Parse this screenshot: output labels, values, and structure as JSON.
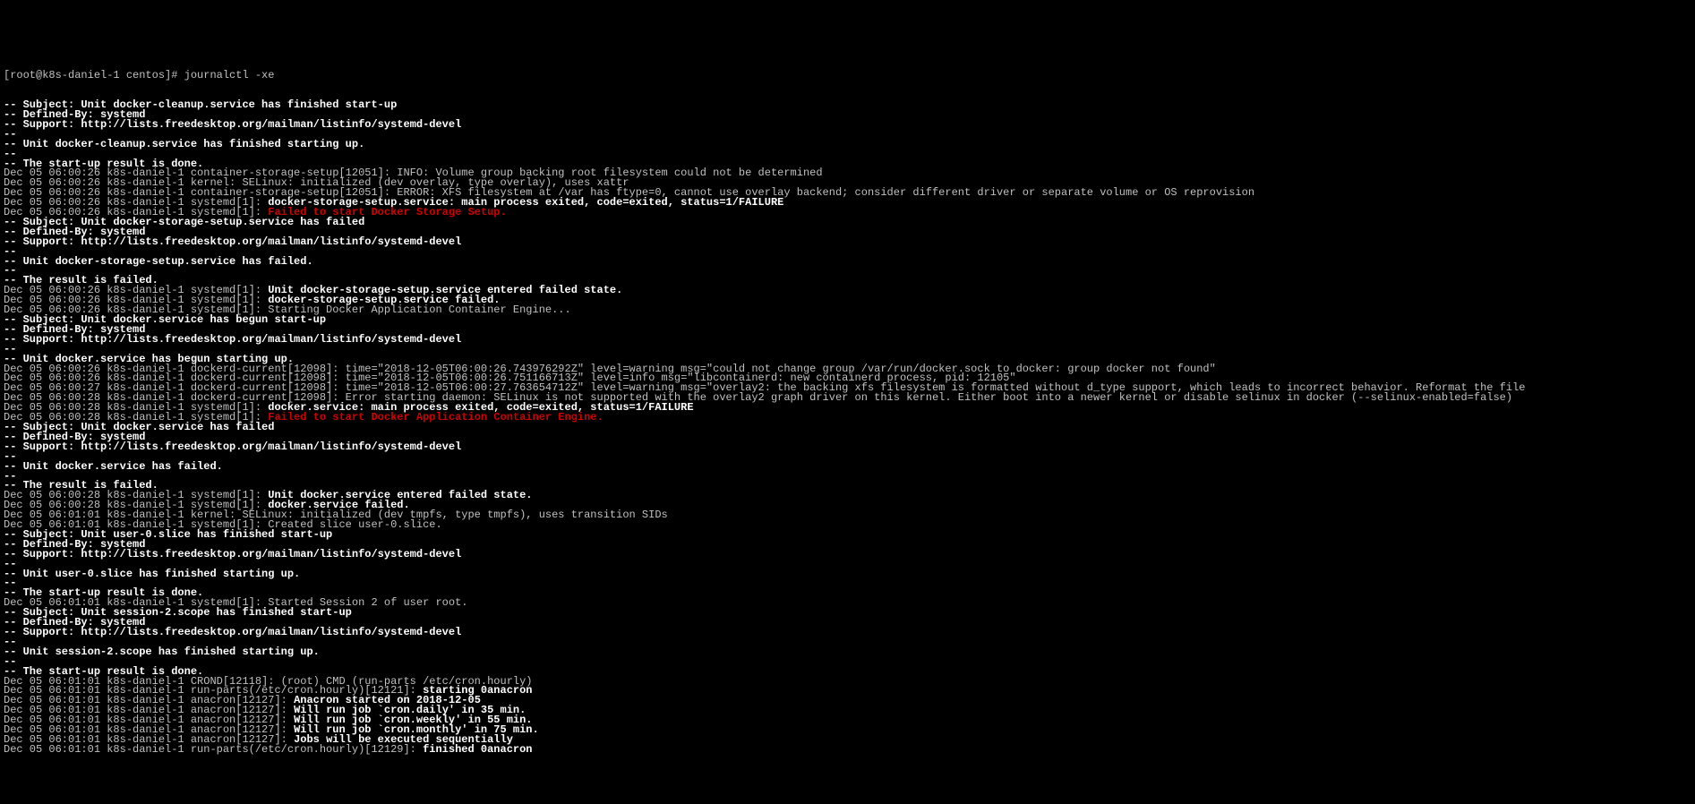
{
  "fs": " ",
  "prompt": "[root@k8s-daniel-1 centos]# ",
  "cmd": "journalctl -xe",
  "lines": [
    [
      "b",
      "-- Subject: Unit docker-cleanup.service has finished start-up"
    ],
    [
      "b",
      "-- Defined-By: systemd"
    ],
    [
      "b",
      "-- Support: http://lists.freedesktop.org/mailman/listinfo/systemd-devel"
    ],
    [
      "b",
      "--"
    ],
    [
      "b",
      "-- Unit docker-cleanup.service has finished starting up."
    ],
    [
      "b",
      "--"
    ],
    [
      "b",
      "-- The start-up result is done."
    ],
    [
      "n",
      "Dec 05 06:00:26 k8s-daniel-1 container-storage-setup[12051]: INFO: Volume group backing root filesystem could not be determined"
    ],
    [
      "n",
      "Dec 05 06:00:26 k8s-daniel-1 kernel: SELinux: initialized (dev overlay, type overlay), uses xattr"
    ],
    [
      "n",
      "Dec 05 06:00:26 k8s-daniel-1 container-storage-setup[12051]: ERROR: XFS filesystem at /var has ftype=0, cannot use overlay backend; consider different driver or separate volume or OS reprovision"
    ],
    [
      [
        "n",
        "Dec 05 06:00:26 k8s-daniel-1 systemd[1]: "
      ],
      [
        "b",
        "docker-storage-setup.service: main process exited, code=exited, status=1/FAILURE"
      ]
    ],
    [
      [
        "n",
        "Dec 05 06:00:26 k8s-daniel-1 systemd[1]: "
      ],
      [
        "r",
        "Failed to start Docker Storage Setup."
      ]
    ],
    [
      "b",
      "-- Subject: Unit docker-storage-setup.service has failed"
    ],
    [
      "b",
      "-- Defined-By: systemd"
    ],
    [
      "b",
      "-- Support: http://lists.freedesktop.org/mailman/listinfo/systemd-devel"
    ],
    [
      "b",
      "--"
    ],
    [
      "b",
      "-- Unit docker-storage-setup.service has failed."
    ],
    [
      "b",
      "--"
    ],
    [
      "b",
      "-- The result is failed."
    ],
    [
      [
        "n",
        "Dec 05 06:00:26 k8s-daniel-1 systemd[1]: "
      ],
      [
        "b",
        "Unit docker-storage-setup.service entered failed state."
      ]
    ],
    [
      [
        "n",
        "Dec 05 06:00:26 k8s-daniel-1 systemd[1]: "
      ],
      [
        "b",
        "docker-storage-setup.service failed."
      ]
    ],
    [
      "n",
      "Dec 05 06:00:26 k8s-daniel-1 systemd[1]: Starting Docker Application Container Engine..."
    ],
    [
      "b",
      "-- Subject: Unit docker.service has begun start-up"
    ],
    [
      "b",
      "-- Defined-By: systemd"
    ],
    [
      "b",
      "-- Support: http://lists.freedesktop.org/mailman/listinfo/systemd-devel"
    ],
    [
      "b",
      "--"
    ],
    [
      "b",
      "-- Unit docker.service has begun starting up."
    ],
    [
      "n",
      "Dec 05 06:00:26 k8s-daniel-1 dockerd-current[12098]: time=\"2018-12-05T06:00:26.743976292Z\" level=warning msg=\"could not change group /var/run/docker.sock to docker: group docker not found\""
    ],
    [
      "n",
      "Dec 05 06:00:26 k8s-daniel-1 dockerd-current[12098]: time=\"2018-12-05T06:00:26.751166713Z\" level=info msg=\"libcontainerd: new containerd process, pid: 12105\""
    ],
    [
      "n",
      "Dec 05 06:00:27 k8s-daniel-1 dockerd-current[12098]: time=\"2018-12-05T06:00:27.763654712Z\" level=warning msg=\"overlay2: the backing xfs filesystem is formatted without d_type support, which leads to incorrect behavior. Reformat the file"
    ],
    [
      "n",
      "Dec 05 06:00:28 k8s-daniel-1 dockerd-current[12098]: Error starting daemon: SELinux is not supported with the overlay2 graph driver on this kernel. Either boot into a newer kernel or disable selinux in docker (--selinux-enabled=false)"
    ],
    [
      [
        "n",
        "Dec 05 06:00:28 k8s-daniel-1 systemd[1]: "
      ],
      [
        "b",
        "docker.service: main process exited, code=exited, status=1/FAILURE"
      ]
    ],
    [
      [
        "n",
        "Dec 05 06:00:28 k8s-daniel-1 systemd[1]: "
      ],
      [
        "r",
        "Failed to start Docker Application Container Engine."
      ]
    ],
    [
      "b",
      "-- Subject: Unit docker.service has failed"
    ],
    [
      "b",
      "-- Defined-By: systemd"
    ],
    [
      "b",
      "-- Support: http://lists.freedesktop.org/mailman/listinfo/systemd-devel"
    ],
    [
      "b",
      "--"
    ],
    [
      "b",
      "-- Unit docker.service has failed."
    ],
    [
      "b",
      "--"
    ],
    [
      "b",
      "-- The result is failed."
    ],
    [
      [
        "n",
        "Dec 05 06:00:28 k8s-daniel-1 systemd[1]: "
      ],
      [
        "b",
        "Unit docker.service entered failed state."
      ]
    ],
    [
      [
        "n",
        "Dec 05 06:00:28 k8s-daniel-1 systemd[1]: "
      ],
      [
        "b",
        "docker.service failed."
      ]
    ],
    [
      "n",
      "Dec 05 06:01:01 k8s-daniel-1 kernel: SELinux: initialized (dev tmpfs, type tmpfs), uses transition SIDs"
    ],
    [
      "n",
      "Dec 05 06:01:01 k8s-daniel-1 systemd[1]: Created slice user-0.slice."
    ],
    [
      "b",
      "-- Subject: Unit user-0.slice has finished start-up"
    ],
    [
      "b",
      "-- Defined-By: systemd"
    ],
    [
      "b",
      "-- Support: http://lists.freedesktop.org/mailman/listinfo/systemd-devel"
    ],
    [
      "b",
      "--"
    ],
    [
      "b",
      "-- Unit user-0.slice has finished starting up."
    ],
    [
      "b",
      "--"
    ],
    [
      "b",
      "-- The start-up result is done."
    ],
    [
      "n",
      "Dec 05 06:01:01 k8s-daniel-1 systemd[1]: Started Session 2 of user root."
    ],
    [
      "b",
      "-- Subject: Unit session-2.scope has finished start-up"
    ],
    [
      "b",
      "-- Defined-By: systemd"
    ],
    [
      "b",
      "-- Support: http://lists.freedesktop.org/mailman/listinfo/systemd-devel"
    ],
    [
      "b",
      "--"
    ],
    [
      "b",
      "-- Unit session-2.scope has finished starting up."
    ],
    [
      "b",
      "--"
    ],
    [
      "b",
      "-- The start-up result is done."
    ],
    [
      "n",
      "Dec 05 06:01:01 k8s-daniel-1 CROND[12118]: (root) CMD (run-parts /etc/cron.hourly)"
    ],
    [
      [
        "n",
        "Dec 05 06:01:01 k8s-daniel-1 run-parts(/etc/cron.hourly)[12121]: "
      ],
      [
        "b",
        "starting 0anacron"
      ]
    ],
    [
      [
        "n",
        "Dec 05 06:01:01 k8s-daniel-1 anacron[12127]: "
      ],
      [
        "b",
        "Anacron started on 2018-12-05"
      ]
    ],
    [
      [
        "n",
        "Dec 05 06:01:01 k8s-daniel-1 anacron[12127]: "
      ],
      [
        "b",
        "Will run job `cron.daily' in 35 min."
      ]
    ],
    [
      [
        "n",
        "Dec 05 06:01:01 k8s-daniel-1 anacron[12127]: "
      ],
      [
        "b",
        "Will run job `cron.weekly' in 55 min."
      ]
    ],
    [
      [
        "n",
        "Dec 05 06:01:01 k8s-daniel-1 anacron[12127]: "
      ],
      [
        "b",
        "Will run job `cron.monthly' in 75 min."
      ]
    ],
    [
      [
        "n",
        "Dec 05 06:01:01 k8s-daniel-1 anacron[12127]: "
      ],
      [
        "b",
        "Jobs will be executed sequentially"
      ]
    ],
    [
      [
        "n",
        "Dec 05 06:01:01 k8s-daniel-1 run-parts(/etc/cron.hourly)[12129]: "
      ],
      [
        "b",
        "finished 0anacron"
      ]
    ]
  ]
}
